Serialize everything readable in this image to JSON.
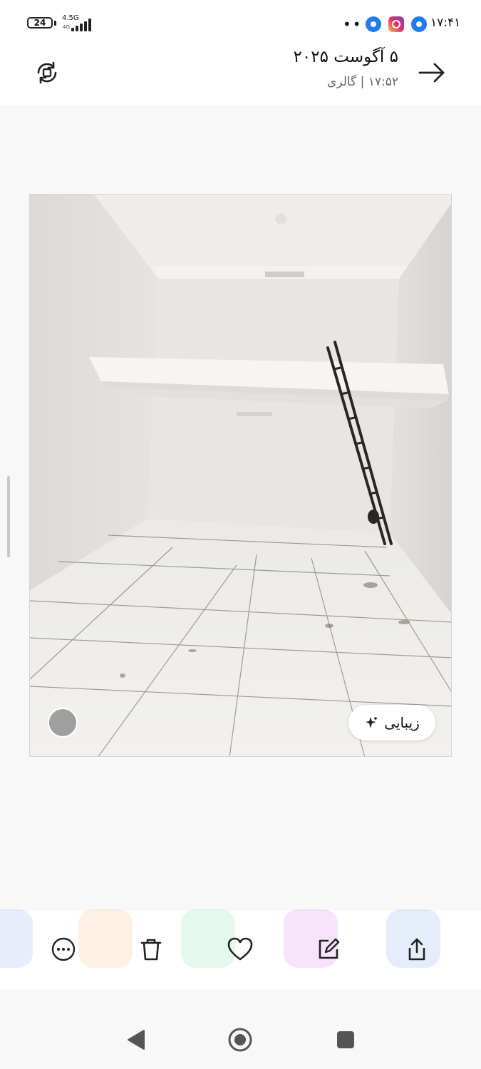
{
  "status_bar": {
    "battery": "24",
    "network": "4.5G",
    "network_sub": "4G",
    "dots": "••",
    "time": "۱۷:۴۱",
    "icons": [
      "battery-icon",
      "signal-icon",
      "app-blue-icon",
      "instagram-icon",
      "app-blue-icon"
    ]
  },
  "header": {
    "title": "۵ آگوست ۲۰۲۵",
    "subtitle": "۱۷:۵۲ | گالری",
    "back_icon": "arrow-right-icon",
    "rotate_icon": "rotate-icon"
  },
  "photo": {
    "beauty_label": "زیبایی",
    "beauty_icon": "sparkle-icon",
    "circle_control": "shutter-circle"
  },
  "toolbar": {
    "items": [
      {
        "name": "more",
        "icon": "more-icon"
      },
      {
        "name": "delete",
        "icon": "trash-icon"
      },
      {
        "name": "favorite",
        "icon": "heart-icon"
      },
      {
        "name": "edit",
        "icon": "edit-icon"
      },
      {
        "name": "share",
        "icon": "share-icon"
      }
    ]
  },
  "navbar": {
    "items": [
      "back-triangle-icon",
      "home-circle-icon",
      "recents-square-icon"
    ]
  },
  "colors": {
    "background": "#f8f8f8",
    "surface": "#ffffff",
    "icon": "#222222"
  }
}
